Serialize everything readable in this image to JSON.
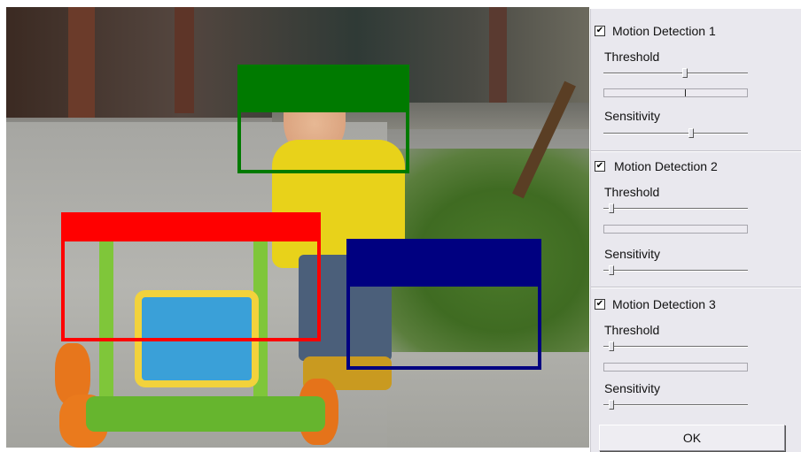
{
  "video": {
    "regions": [
      {
        "name": "Motion Detection 1",
        "color": "#007a00"
      },
      {
        "name": "Motion Detection 2",
        "color": "#ff0000"
      },
      {
        "name": "Motion Detection 3",
        "color": "#000080"
      }
    ]
  },
  "panel": {
    "groups": [
      {
        "title": "Motion Detection 1",
        "checked": true,
        "check_glyph": "✔",
        "threshold_label": "Threshold",
        "threshold_value": 0.57,
        "motion_level": 0.57,
        "sensitivity_label": "Sensitivity",
        "sensitivity_value": 0.61
      },
      {
        "title": "Motion Detection 2",
        "checked": true,
        "check_glyph": "✔",
        "threshold_label": "Threshold",
        "threshold_value": 0.04,
        "motion_level": 0,
        "sensitivity_label": "Sensitivity",
        "sensitivity_value": 0.04
      },
      {
        "title": "Motion Detection 3",
        "checked": true,
        "check_glyph": "✔",
        "threshold_label": "Threshold",
        "threshold_value": 0.04,
        "motion_level": 0,
        "sensitivity_label": "Sensitivity",
        "sensitivity_value": 0.04
      }
    ],
    "ok_label": "OK"
  }
}
